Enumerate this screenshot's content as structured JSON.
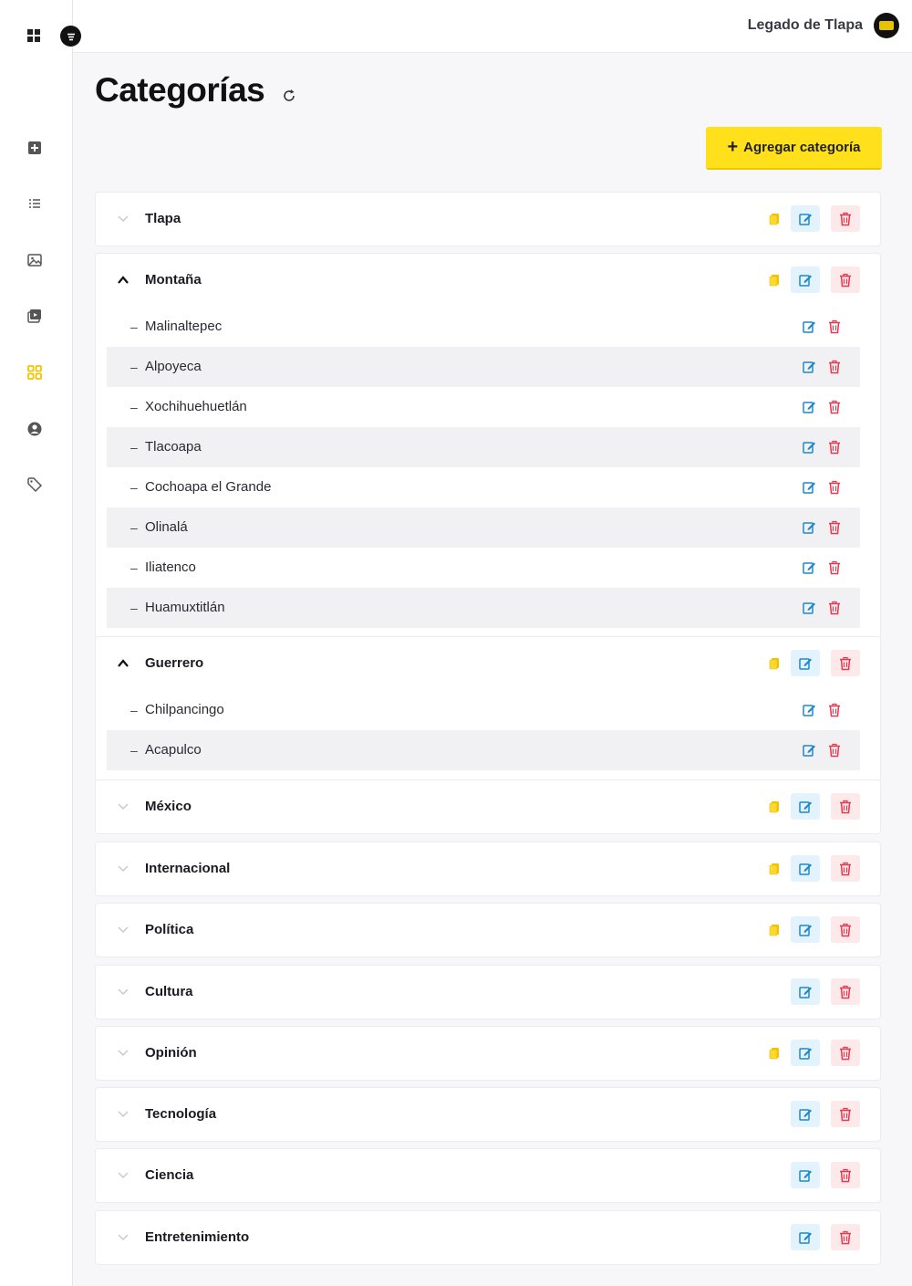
{
  "brand": "Legado de Tlapa",
  "page_title": "Categorías",
  "add_button": "Agregar categoría",
  "sidebar_icons": [
    "add-post-icon",
    "list-icon",
    "image-icon",
    "video-icon",
    "categories-icon",
    "user-icon",
    "tag-icon"
  ],
  "colors": {
    "accent": "#ffe01b",
    "edit": "#1e88c7",
    "delete": "#e53950",
    "active_sidebar": "#f2c400"
  },
  "categories": [
    {
      "name": "Tlapa",
      "expanded": false,
      "starred": true,
      "children": []
    },
    {
      "name": "Montaña",
      "expanded": true,
      "starred": true,
      "children": [
        "Malinaltepec",
        "Alpoyeca",
        "Xochihuehuetlán",
        "Tlacoapa",
        "Cochoapa el Grande",
        "Olinalá",
        "Iliatenco",
        "Huamuxtitlán"
      ]
    },
    {
      "name": "Guerrero",
      "expanded": true,
      "starred": true,
      "children": [
        "Chilpancingo",
        "Acapulco"
      ]
    },
    {
      "name": "México",
      "expanded": false,
      "starred": true,
      "children": []
    },
    {
      "name": "Internacional",
      "expanded": false,
      "starred": true,
      "children": []
    },
    {
      "name": "Política",
      "expanded": false,
      "starred": true,
      "children": []
    },
    {
      "name": "Cultura",
      "expanded": false,
      "starred": false,
      "children": []
    },
    {
      "name": "Opinión",
      "expanded": false,
      "starred": true,
      "children": []
    },
    {
      "name": "Tecnología",
      "expanded": false,
      "starred": false,
      "children": []
    },
    {
      "name": "Ciencia",
      "expanded": false,
      "starred": false,
      "children": []
    },
    {
      "name": "Entretenimiento",
      "expanded": false,
      "starred": false,
      "children": []
    }
  ]
}
